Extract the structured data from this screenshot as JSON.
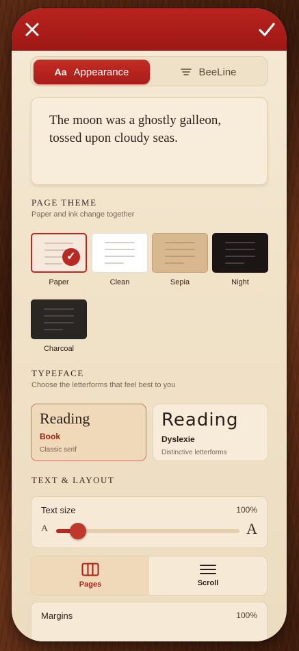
{
  "header": {
    "close_icon": "close-icon",
    "done_icon": "checkmark-icon"
  },
  "tabs": [
    {
      "label": "Appearance",
      "icon": "Aa"
    },
    {
      "label": "BeeLine",
      "icon": "lines-icon"
    }
  ],
  "preview": {
    "text": "The moon was a ghostly galleon, tossed upon cloudy seas."
  },
  "page_theme": {
    "title": "PAGE THEME",
    "subtitle": "Paper and ink change together",
    "options": [
      {
        "label": "Paper",
        "selected": true,
        "bg": "#f6e9dc",
        "ink": "#d9c3b6"
      },
      {
        "label": "Clean",
        "selected": false,
        "bg": "#ffffff",
        "ink": "#d5d0cb"
      },
      {
        "label": "Sepia",
        "selected": false,
        "bg": "#d8b98f",
        "ink": "#bf9e74"
      },
      {
        "label": "Night",
        "selected": false,
        "bg": "#1b1615",
        "ink": "#4a403b"
      },
      {
        "label": "Charcoal",
        "selected": false,
        "bg": "#2a2624",
        "ink": "#4e4743"
      }
    ]
  },
  "typeface": {
    "title": "TYPEFACE",
    "subtitle": "Choose the letterforms that feel best to you",
    "options": [
      {
        "sample": "Reading",
        "name": "Book",
        "desc": "Classic serif",
        "selected": true
      },
      {
        "sample": "Reading",
        "name": "Dyslexie",
        "desc": "Distinctive letterforms",
        "selected": false
      }
    ]
  },
  "text_layout": {
    "title": "TEXT & LAYOUT",
    "text_size": {
      "label": "Text size",
      "value": "100%",
      "small_glyph": "A",
      "big_glyph": "A",
      "level": 0.12
    },
    "modes": [
      {
        "label": "Pages",
        "icon": "columns-icon",
        "selected": true
      },
      {
        "label": "Scroll",
        "icon": "scroll-lines-icon",
        "selected": false
      }
    ],
    "margins": {
      "label": "Margins",
      "value": "100%"
    }
  },
  "colors": {
    "accent": "#b72a23",
    "header": "#b8231e"
  }
}
